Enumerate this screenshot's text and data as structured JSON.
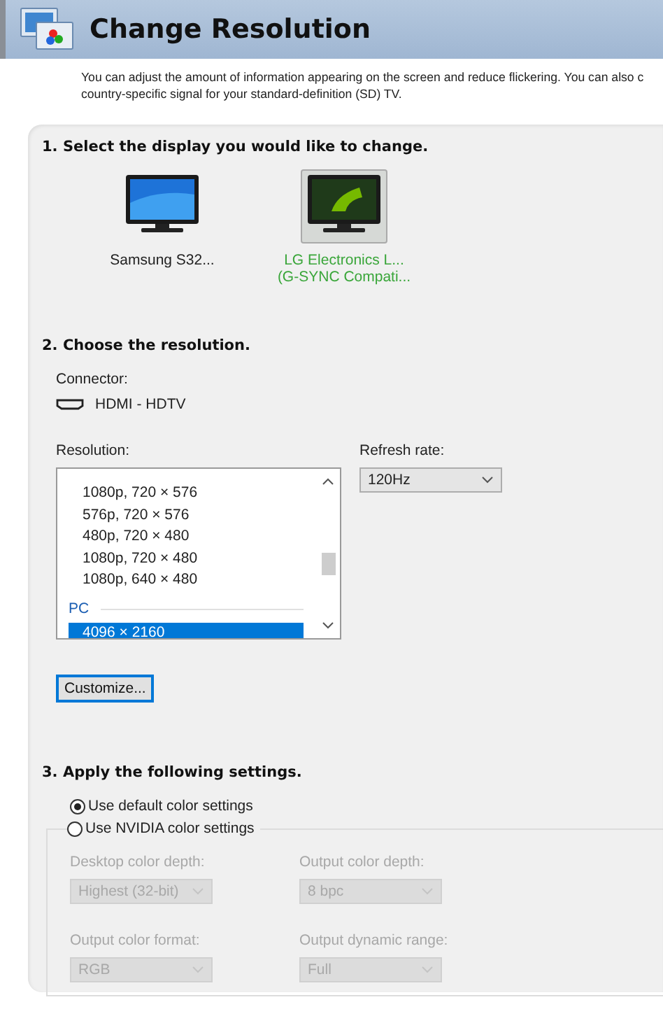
{
  "header": {
    "title": "Change Resolution"
  },
  "description": [
    "You can adjust the amount of information appearing on the screen and reduce flickering. You can also c",
    "country-specific signal for your standard-definition (SD) TV."
  ],
  "section_1": {
    "heading": "1. Select the display you would like to change.",
    "displays": [
      {
        "kind": "desktop",
        "lines": [
          "Samsung S32..."
        ],
        "selected": false
      },
      {
        "kind": "nvidia",
        "lines": [
          "LG Electronics L...",
          "(G-SYNC Compati..."
        ],
        "selected": true
      }
    ]
  },
  "section_2": {
    "heading": "2. Choose the resolution.",
    "connector_label": "Connector:",
    "connector": "HDMI - HDTV",
    "resolution_label": "Resolution:",
    "resolutions": [
      {
        "kind": "item",
        "label": "1080p, 720 × 576",
        "selected": false
      },
      {
        "kind": "item",
        "label": "576p, 720 × 576",
        "selected": false
      },
      {
        "kind": "item",
        "label": "480p, 720 × 480",
        "selected": false
      },
      {
        "kind": "item",
        "label": "1080p, 720 × 480",
        "selected": false
      },
      {
        "kind": "item",
        "label": "1080p, 640 × 480",
        "selected": false
      },
      {
        "kind": "group",
        "label": "PC"
      },
      {
        "kind": "item",
        "label": "4096 × 2160",
        "selected": true
      }
    ],
    "refresh_label": "Refresh rate:",
    "refresh_value": "120Hz",
    "customize_button": "Customize..."
  },
  "section_3": {
    "heading": "3. Apply the following settings.",
    "options": [
      {
        "label": "Use default color settings",
        "selected": true
      },
      {
        "label": "Use NVIDIA color settings",
        "selected": false
      }
    ],
    "fields": [
      {
        "label": "Desktop color depth:",
        "value": "Highest (32-bit)",
        "disabled": true
      },
      {
        "label": "Output color depth:",
        "value": "8 bpc",
        "disabled": true
      },
      {
        "label": "Output color format:",
        "value": "RGB",
        "disabled": true
      },
      {
        "label": "Output dynamic range:",
        "value": "Full",
        "disabled": true
      }
    ]
  }
}
